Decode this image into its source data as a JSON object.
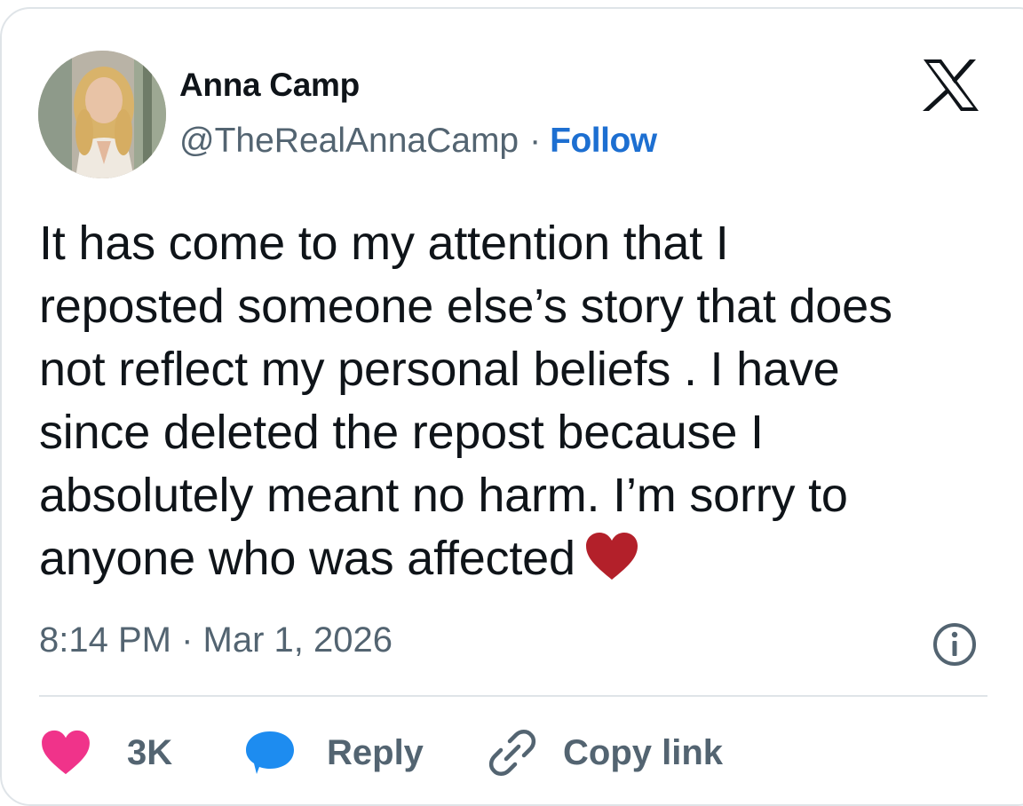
{
  "author": {
    "name": "Anna Camp",
    "handle": "@TheRealAnnaCamp",
    "separator": "·",
    "follow_label": "Follow",
    "avatar_icon": "profile-photo"
  },
  "brand": {
    "logo_icon": "x-logo-icon"
  },
  "post": {
    "lines": [
      "It has come to my attention that I",
      "reposted someone else’s story that does",
      "not reflect my personal beliefs . I have",
      "since deleted the repost because I",
      "absolutely meant no harm. I’m sorry to",
      "anyone who was affected"
    ],
    "trailing_emoji": "red-heart-emoji",
    "timestamp": "8:14 PM · Mar 1, 2026",
    "info_icon": "info-icon"
  },
  "actions": {
    "like": {
      "icon": "heart-icon",
      "label": "3K"
    },
    "reply": {
      "icon": "speech-bubble-icon",
      "label": "Reply"
    },
    "copy": {
      "icon": "link-icon",
      "label": "Copy link"
    }
  },
  "colors": {
    "text": "#0f1419",
    "secondary": "#536471",
    "follow": "#1d6fd1",
    "like_heart": "#f0338a",
    "reply_bubble": "#1d8cf0",
    "red_heart_emoji": "#b3202a",
    "divider": "#dfe4e8"
  }
}
